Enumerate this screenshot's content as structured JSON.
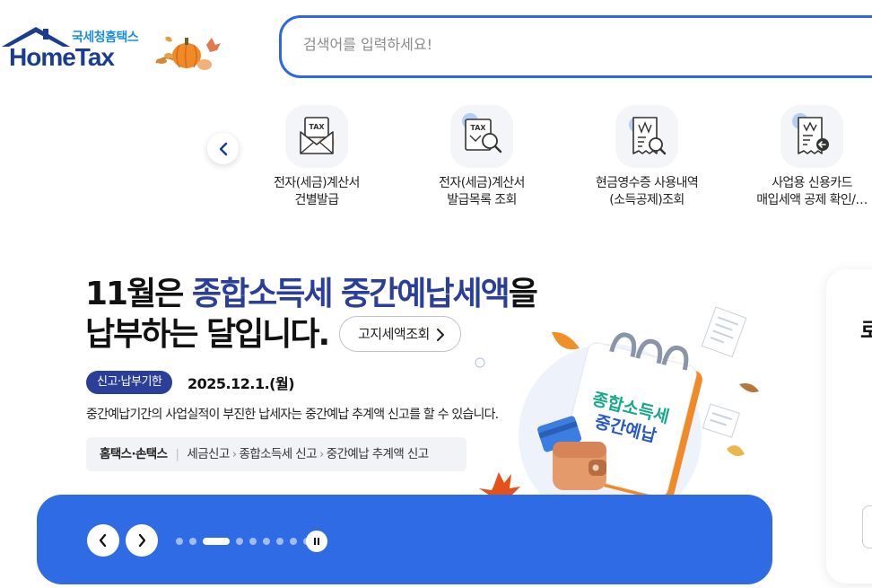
{
  "header": {
    "logo_subtitle": "국세청홈택스",
    "logo_title": "HomeTax",
    "search_placeholder": "검색어를 입력하세요!"
  },
  "quick_menu": {
    "items": [
      {
        "line1": "전자(세금)계산서",
        "line2": "건별발급",
        "icon": "tax-invoice-envelope-icon"
      },
      {
        "line1": "전자(세금)계산서",
        "line2": "발급목록 조회",
        "icon": "tax-invoice-search-icon"
      },
      {
        "line1": "현금영수증 사용내역",
        "line2": "(소득공제)조회",
        "icon": "cash-receipt-search-icon"
      },
      {
        "line1": "사업용 신용카드",
        "line2": "매입세액 공제 확인/…",
        "icon": "business-card-receipt-icon"
      }
    ]
  },
  "banner": {
    "title_l1_a": "11월은 ",
    "title_l1_b": "종합소득세 중간예납세액",
    "title_l1_c": "을",
    "title_l2": "납부하는 달입니다.",
    "lookup_button": "고지세액조회",
    "badge": "신고·납부기한",
    "date": "2025.12.1.(월)",
    "description": "중간예납기간의 사업실적이 부진한 납세자는 중간예납 추계액 신고를 할 수 있습니다.",
    "path_home": "홈택스·손택스",
    "path": [
      "세금신고",
      "종합소득세 신고",
      "중간예납 추계액 신고"
    ],
    "calendar_text_l1": "종합소득세",
    "calendar_text_l2": "중간예납",
    "slide_count": 9,
    "active_slide": 3
  },
  "side_panel": {
    "partial_heading": "로"
  },
  "colors": {
    "brand_navy": "#2b3f98",
    "search_border": "#2f67e0",
    "banner_bar": "#2f6be4",
    "logo_blue": "#1a3d8f",
    "logo_cyan": "#1d8fd8"
  }
}
